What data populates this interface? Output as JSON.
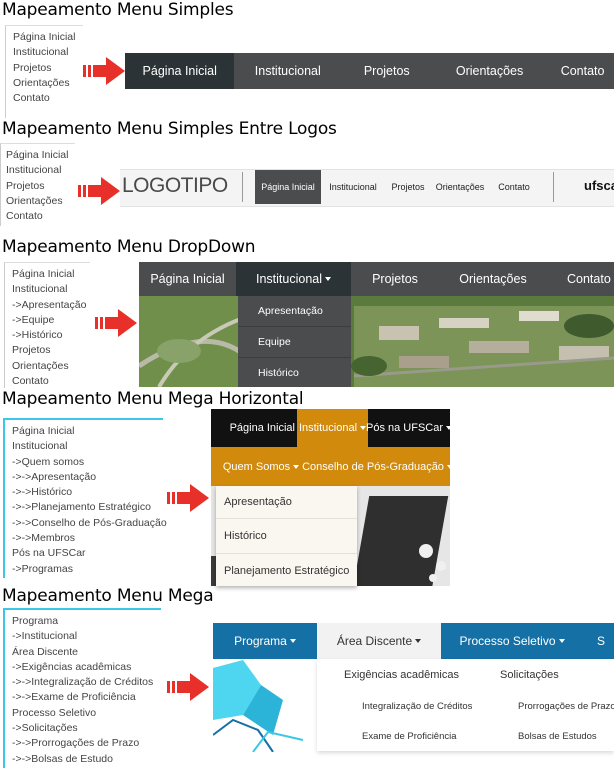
{
  "sections": {
    "simples": {
      "title": "Mapeamento Menu Simples",
      "list": [
        "Página Inicial",
        "Institucional",
        "Projetos",
        "Orientações",
        "Contato"
      ],
      "nav": [
        "Página Inicial",
        "Institucional",
        "Projetos",
        "Orientações",
        "Contato"
      ]
    },
    "logos": {
      "title": "Mapeamento Menu Simples Entre Logos",
      "list": [
        "Página Inicial",
        "Institucional",
        "Projetos",
        "Orientações",
        "Contato"
      ],
      "logo_left": "LOGOTIPO",
      "logo_right": "ufscar",
      "nav": [
        "Página Inicial",
        "Institucional",
        "Projetos",
        "Orientações",
        "Contato"
      ]
    },
    "dropdown": {
      "title": "Mapeamento Menu DropDown",
      "list": [
        "Página Inicial",
        "Institucional",
        "->Apresentação",
        "->Equipe",
        "->Histórico",
        "Projetos",
        "Orientações",
        "Contato"
      ],
      "nav": [
        "Página Inicial",
        "Institucional",
        "Projetos",
        "Orientações",
        "Contato"
      ],
      "submenu": [
        "Apresentação",
        "Equipe",
        "Histórico"
      ]
    },
    "mega_horizontal": {
      "title": "Mapeamento Menu Mega Horizontal",
      "list": [
        "Página Inicial",
        "Institucional",
        "->Quem somos",
        "->->Apresentação",
        "->->Histórico",
        "->->Planejamento Estratégico",
        "->->Conselho de Pós-Graduação",
        "->->Membros",
        "Pós na UFSCar",
        "->Programas"
      ],
      "nav": [
        "Página Inicial",
        "Institucional",
        "Pós na UFSCar"
      ],
      "subnav": [
        "Quem Somos",
        "Conselho de Pós-Graduação"
      ],
      "dropdown": [
        "Apresentação",
        "Histórico",
        "Planejamento Estratégico"
      ]
    },
    "mega": {
      "title": "Mapeamento Menu Mega",
      "list": [
        "Programa",
        "->Institucional",
        "Área Discente",
        "->Exigências acadêmicas",
        "->->Integralização de Créditos",
        "->->Exame de Proficiência",
        "Processo Seletivo",
        "->Solicitações",
        "->->Prorrogações de Prazo",
        "->->Bolsas de Estudo"
      ],
      "nav": [
        "Programa",
        "Área Discente",
        "Processo Seletivo",
        "S"
      ],
      "col1_head": "Exigências acadêmicas",
      "col1_items": [
        "Integralização de Créditos",
        "Exame de Proficiência"
      ],
      "col2_head": "Solicitações",
      "col2_items": [
        "Prorrogações de Prazo",
        "Bolsas de Estudos"
      ]
    }
  },
  "colors": {
    "nav_dark": "#4a4c4e",
    "nav_active": "#2b3336",
    "orange": "#d18a0c",
    "blue": "#1570a6",
    "arrow_red": "#e8302a",
    "cyan": "#3cc6e8"
  }
}
